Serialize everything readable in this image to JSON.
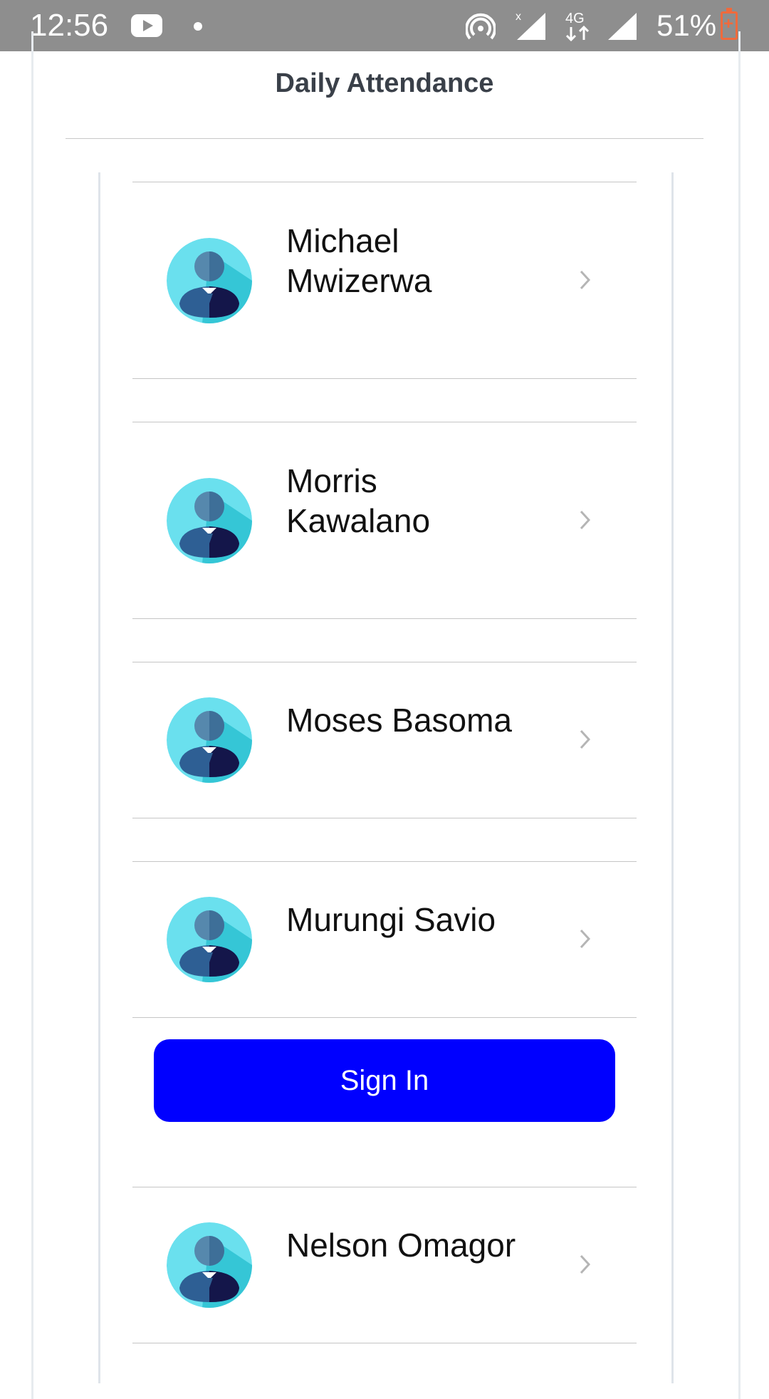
{
  "status_bar": {
    "time": "12:56",
    "battery": "51%",
    "network": "4G",
    "icons": [
      "youtube-icon",
      "notification-dot-icon",
      "hotspot-icon",
      "signal-icon",
      "4g-icon",
      "signal-icon",
      "battery-charging-icon"
    ]
  },
  "header": {
    "title": "Daily Attendance"
  },
  "people": [
    {
      "name": "Michael\nMwizerwa"
    },
    {
      "name": "Morris\nKawalano"
    },
    {
      "name": "Moses Basoma"
    },
    {
      "name": "Murungi Savio"
    },
    {
      "name": "Nelson Omagor"
    }
  ],
  "signin": {
    "label": "Sign In"
  },
  "colors": {
    "status_bar": "#8e8e8e",
    "button": "#0000ff",
    "avatar_bg": "#6ae0ee",
    "battery": "#f06a3c"
  }
}
